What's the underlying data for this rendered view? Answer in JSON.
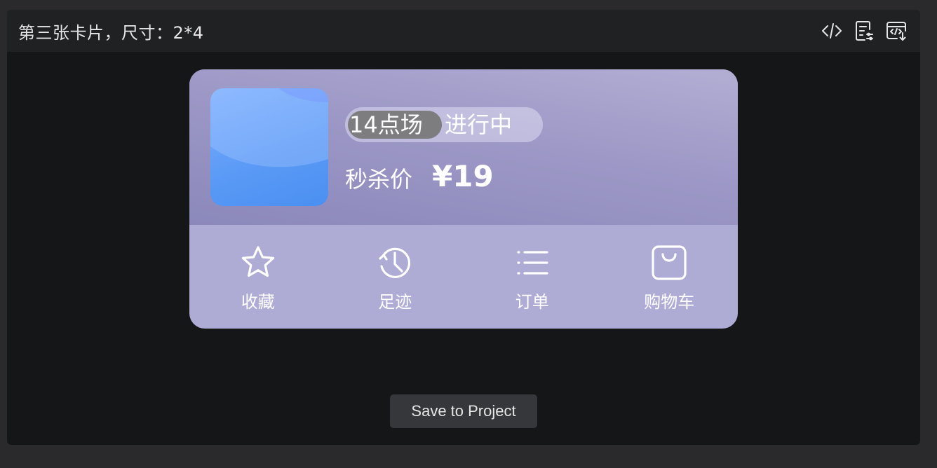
{
  "header": {
    "title": "第三张卡片，尺寸：2*4",
    "icons": [
      "code-icon",
      "document-settings-icon",
      "code-window-icon"
    ]
  },
  "card": {
    "session_time": "14点场",
    "session_status": "进行中",
    "price_label": "秒杀价",
    "price_value": "¥19",
    "actions": [
      {
        "label": "收藏",
        "icon": "star-icon"
      },
      {
        "label": "足迹",
        "icon": "clock-icon"
      },
      {
        "label": "订单",
        "icon": "list-icon"
      },
      {
        "label": "购物车",
        "icon": "shopping-bag-icon"
      }
    ],
    "colors": {
      "top_gradient": "#9d98c6",
      "bottom_bg": "#aeabd5",
      "thumb_blue": "#5c9bf6"
    }
  },
  "footer": {
    "save_label": "Save to Project"
  }
}
